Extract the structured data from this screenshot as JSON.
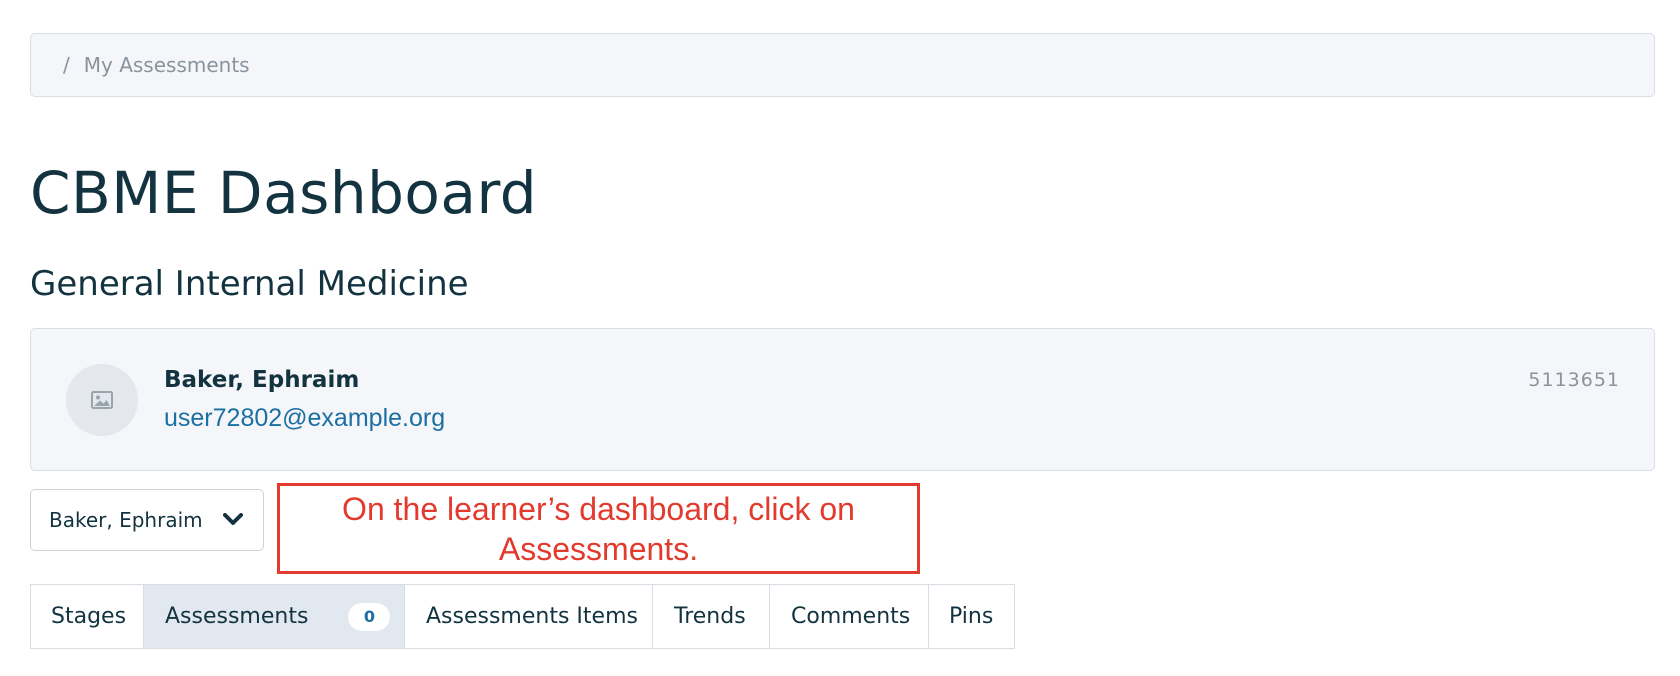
{
  "breadcrumb": {
    "separator": "/",
    "current": "My Assessments"
  },
  "page": {
    "title": "CBME Dashboard",
    "subtitle": "General Internal Medicine"
  },
  "learner": {
    "name": "Baker, Ephraim",
    "email": "user72802@example.org",
    "number": "5113651",
    "avatar_icon": "image-placeholder-icon"
  },
  "learner_select": {
    "value": "Baker, Ephraim",
    "icon": "chevron-down-icon"
  },
  "callout": {
    "text": "On the learner’s dashboard, click on Assessments.",
    "color": "#e23b2e"
  },
  "tabs": [
    {
      "label": "Stages",
      "active": false
    },
    {
      "label": "Assessments",
      "active": true,
      "badge": "0"
    },
    {
      "label": "Assessments Items",
      "active": false
    },
    {
      "label": "Trends",
      "active": false
    },
    {
      "label": "Comments",
      "active": false
    },
    {
      "label": "Pins",
      "active": false
    }
  ],
  "colors": {
    "title": "#12333f",
    "link": "#1c6fa3",
    "panel_bg": "#f4f6f9",
    "active_tab_bg": "#e2e8ef"
  }
}
